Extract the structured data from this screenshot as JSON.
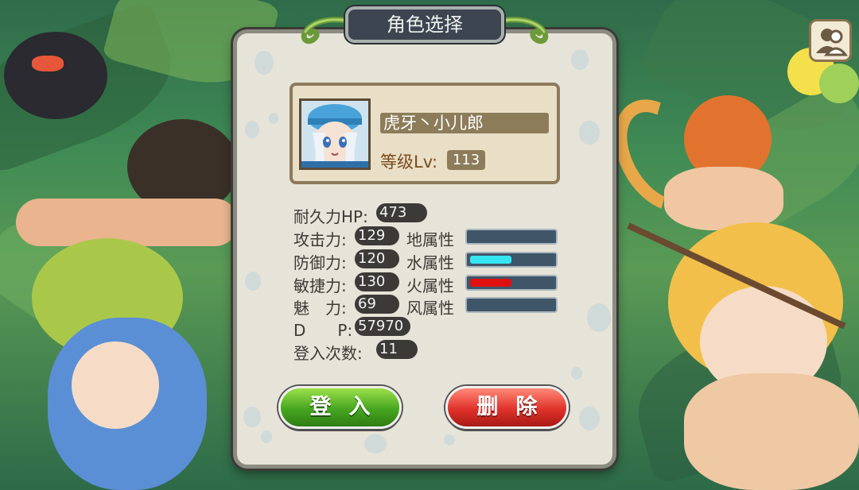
{
  "dialog": {
    "title": "角色选择",
    "character": {
      "name": "虎牙丶小儿郎",
      "level_label": "等级Lv:",
      "level": "113"
    },
    "stats": [
      {
        "label": "耐久力HP:",
        "value": "473"
      },
      {
        "label": "攻击力:",
        "value": "129"
      },
      {
        "label": "防御力:",
        "value": "120"
      },
      {
        "label": "敏捷力:",
        "value": "130"
      },
      {
        "label": "魅　力:",
        "value": "69"
      },
      {
        "label": "D　　P:",
        "value": "57970"
      },
      {
        "label": "登入次数:",
        "value": "11"
      }
    ],
    "attributes": [
      {
        "label": "地属性",
        "level": 0,
        "color": "#3f5568"
      },
      {
        "label": "水属性",
        "level": 0.5,
        "color": "#35e6f2"
      },
      {
        "label": "火属性",
        "level": 0.5,
        "color": "#e01010"
      },
      {
        "label": "风属性",
        "level": 0,
        "color": "#3f5568"
      }
    ],
    "login_button": "登入",
    "delete_button": "删除"
  },
  "friend_button_icon": "friends-icon"
}
